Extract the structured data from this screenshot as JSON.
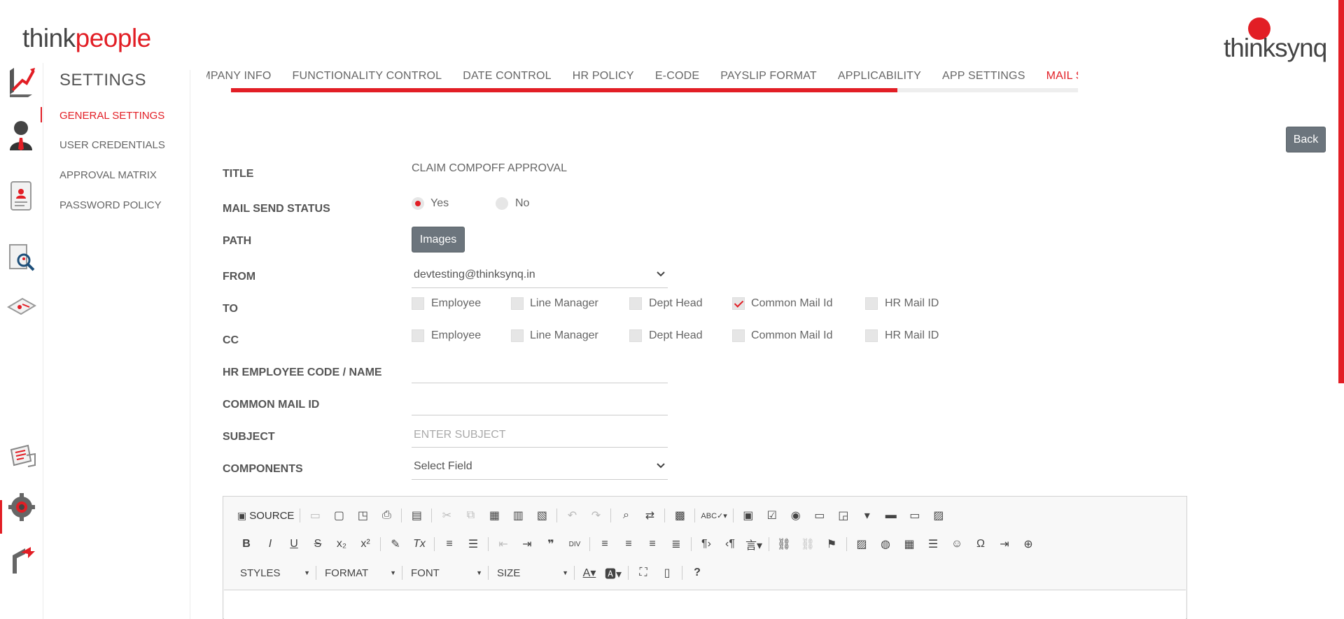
{
  "header": {
    "logo_left_a": "think",
    "logo_left_b": "people",
    "logo_right": "thinksynq"
  },
  "rail": {
    "icons": [
      "trend-chart-icon",
      "employee-profile-icon",
      "document-profile-icon",
      "search-report-icon",
      "id-card-icon",
      "messages-icon",
      "settings-gear-icon",
      "logout-arrow-icon"
    ]
  },
  "sidebar": {
    "title": "SETTINGS",
    "items": [
      {
        "label": "GENERAL SETTINGS",
        "active": true
      },
      {
        "label": "USER CREDENTIALS",
        "active": false
      },
      {
        "label": "APPROVAL MATRIX",
        "active": false
      },
      {
        "label": "PASSWORD POLICY",
        "active": false
      }
    ]
  },
  "tabs": [
    {
      "label": "COMPANY INFO",
      "active": false
    },
    {
      "label": "FUNCTIONALITY CONTROL",
      "active": false
    },
    {
      "label": "DATE CONTROL",
      "active": false
    },
    {
      "label": "HR POLICY",
      "active": false
    },
    {
      "label": "E-CODE",
      "active": false
    },
    {
      "label": "PAYSLIP FORMAT",
      "active": false
    },
    {
      "label": "APPLICABILITY",
      "active": false
    },
    {
      "label": "APP SETTINGS",
      "active": false
    },
    {
      "label": "MAIL SETTINGS",
      "active": true
    }
  ],
  "back_label": "Back",
  "form": {
    "title_label": "TITLE",
    "title_value": "CLAIM COMPOFF APPROVAL",
    "mail_status_label": "MAIL SEND STATUS",
    "yes_label": "Yes",
    "no_label": "No",
    "mail_status_value": "Yes",
    "path_label": "PATH",
    "images_btn": "Images",
    "from_label": "FROM",
    "from_value": "devtesting@thinksynq.in",
    "to_label": "TO",
    "cc_label": "CC",
    "to_options": [
      {
        "label": "Employee",
        "checked": false
      },
      {
        "label": "Line Manager",
        "checked": false
      },
      {
        "label": "Dept Head",
        "checked": false
      },
      {
        "label": "Common Mail Id",
        "checked": true
      },
      {
        "label": "HR Mail ID",
        "checked": false
      }
    ],
    "cc_options": [
      {
        "label": "Employee",
        "checked": false
      },
      {
        "label": "Line Manager",
        "checked": false
      },
      {
        "label": "Dept Head",
        "checked": false
      },
      {
        "label": "Common Mail Id",
        "checked": false
      },
      {
        "label": "HR Mail ID",
        "checked": false
      }
    ],
    "hr_emp_label": "HR EMPLOYEE CODE / NAME",
    "hr_emp_value": "",
    "common_mail_label": "COMMON MAIL ID",
    "common_mail_value": "",
    "subject_label": "SUBJECT",
    "subject_placeholder": "ENTER SUBJECT",
    "components_label": "COMPONENTS",
    "components_value": "Select Field"
  },
  "editor": {
    "source_label": "SOURCE",
    "styles_label": "STYLES",
    "format_label": "FORMAT",
    "font_label": "FONT",
    "size_label": "SIZE",
    "help_label": "?"
  },
  "colors": {
    "accent": "#e21e25",
    "button_gray": "#6c757d"
  }
}
